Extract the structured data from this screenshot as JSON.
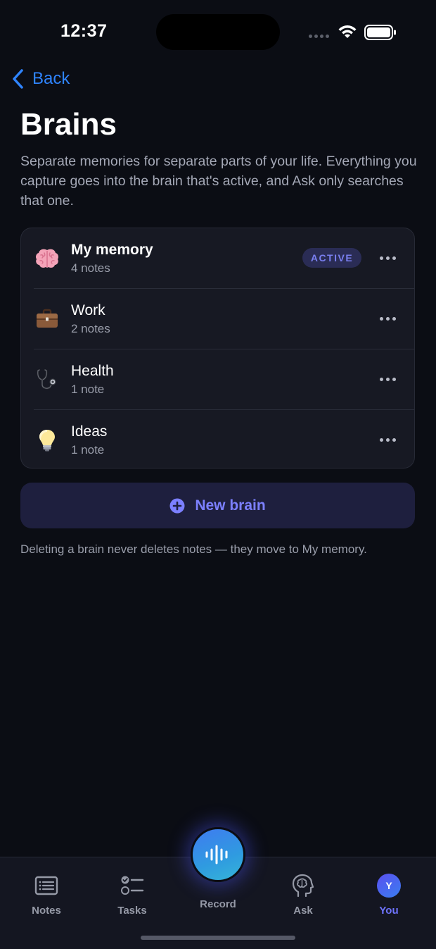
{
  "status_bar": {
    "time": "12:37"
  },
  "nav": {
    "back_label": "Back"
  },
  "page": {
    "title": "Brains",
    "description": "Separate memories for separate parts of your life. Everything you capture goes into the brain that's active, and Ask only searches that one."
  },
  "brains": [
    {
      "emoji": "🧠",
      "name": "My memory",
      "count": "4 notes",
      "active": true,
      "badge": "ACTIVE"
    },
    {
      "emoji": "💼",
      "name": "Work",
      "count": "2 notes",
      "active": false
    },
    {
      "emoji": "🩺",
      "name": "Health",
      "count": "1 note",
      "active": false
    },
    {
      "emoji": "💡",
      "name": "Ideas",
      "count": "1 note",
      "active": false
    }
  ],
  "new_brain": {
    "label": "New brain",
    "icon": "plus-circle-icon"
  },
  "footnote": "Deleting a brain never deletes notes — they move to My memory.",
  "tab_bar": {
    "tabs": [
      {
        "label": "Notes",
        "icon": "notes-icon"
      },
      {
        "label": "Tasks",
        "icon": "tasks-icon"
      },
      {
        "label": "Record",
        "icon": "waveform-icon"
      },
      {
        "label": "Ask",
        "icon": "brain-head-icon"
      },
      {
        "label": "You",
        "icon": "avatar",
        "selected": true,
        "avatar_letter": "Y"
      }
    ]
  },
  "colors": {
    "background": "#0b0d14",
    "accent": "#6f74ff",
    "link": "#2f84ff",
    "card": "#171923"
  }
}
